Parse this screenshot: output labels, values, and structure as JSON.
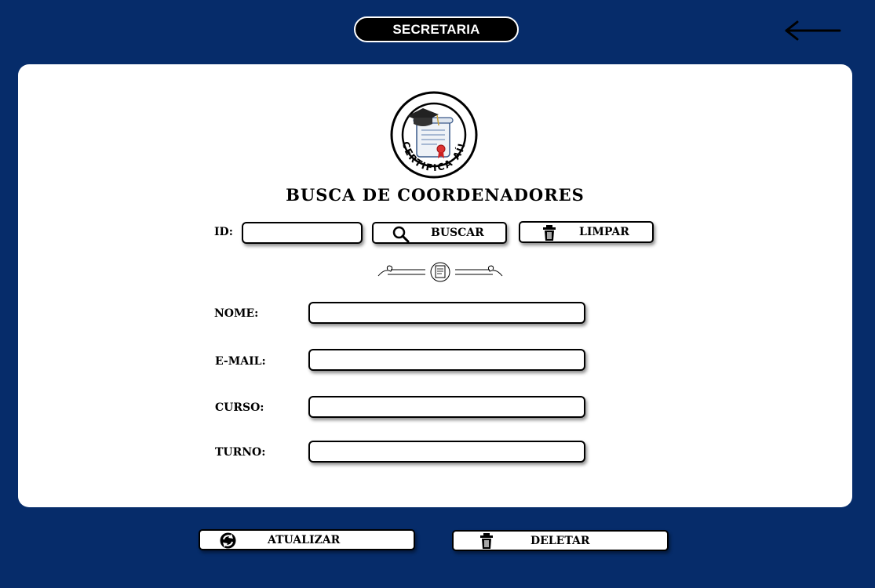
{
  "header": {
    "title": "SECRETARIA",
    "back_icon": "arrow-left-icon"
  },
  "logo": {
    "text": "CERTIFICA AÍ!",
    "icon": "graduation-certificate-logo"
  },
  "page_title": "BUSCA DE COORDENADORES",
  "search": {
    "id_label": "ID:",
    "id_value": "",
    "search_button": "BUSCAR",
    "search_icon": "search-icon",
    "clear_button": "LIMPAR",
    "clear_icon": "trash-icon"
  },
  "divider_icon": "ornamental-divider",
  "fields": {
    "nome": {
      "label": "NOME:",
      "value": ""
    },
    "email": {
      "label": "E-MAIL:",
      "value": ""
    },
    "curso": {
      "label": "CURSO:",
      "value": ""
    },
    "turno": {
      "label": "TURNO:",
      "value": ""
    }
  },
  "actions": {
    "update_button": "ATUALIZAR",
    "update_icon": "refresh-icon",
    "delete_button": "DELETAR",
    "delete_icon": "trash-icon"
  },
  "colors": {
    "background": "#062c6a",
    "card": "#ffffff",
    "accent": "#000000"
  }
}
